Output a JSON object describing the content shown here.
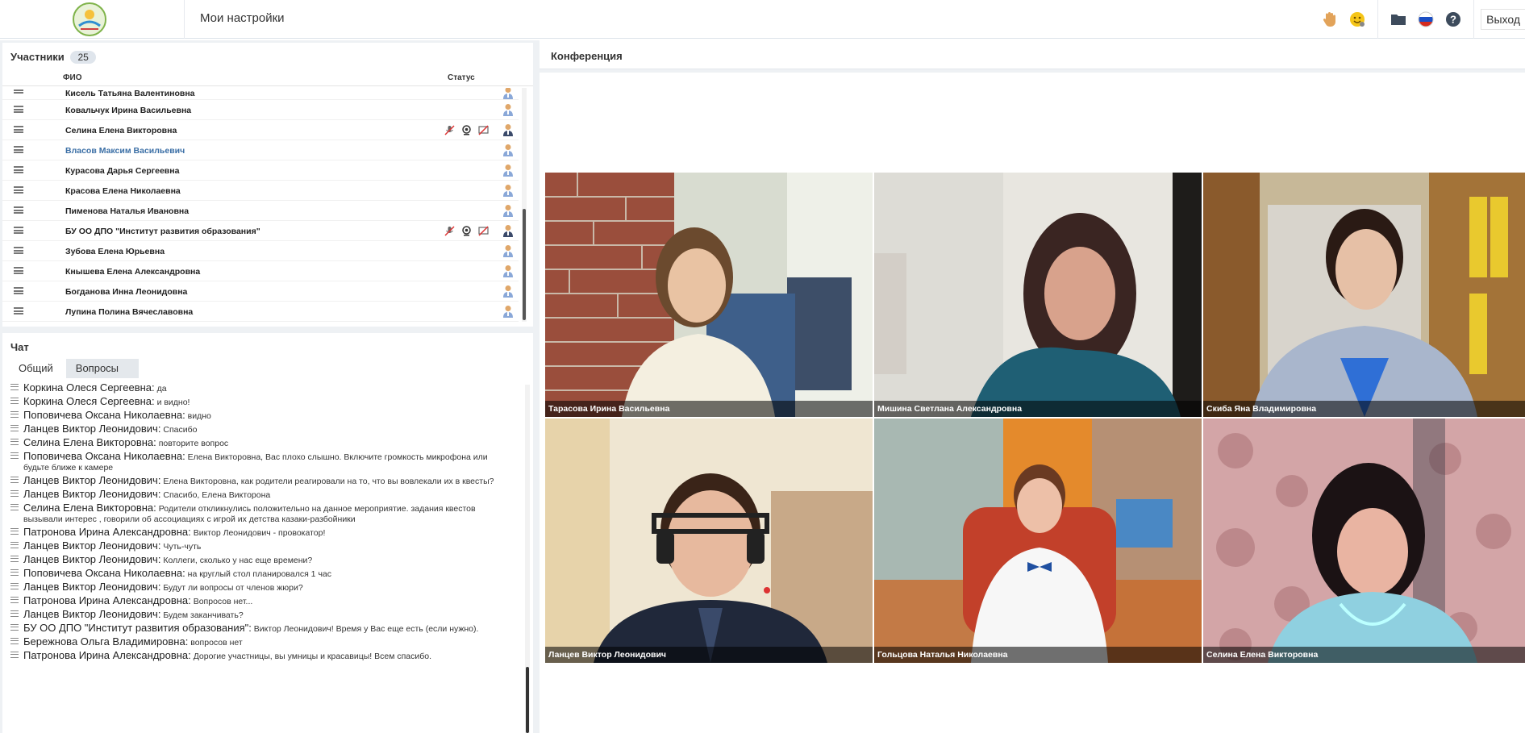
{
  "header": {
    "settings_label": "Мои настройки",
    "exit_label": "Выход"
  },
  "participants": {
    "title": "Участники",
    "count": "25",
    "col_fio": "ФИО",
    "col_status": "Статус",
    "rows": [
      {
        "name": "Кисель Татьяна Валентиновна"
      },
      {
        "name": "Ковальчук Ирина   Васильевна"
      },
      {
        "name": "Селина Елена Викторовна"
      },
      {
        "name": "Власов Максим Васильевич"
      },
      {
        "name": "Курасова Дарья Сергеевна"
      },
      {
        "name": "Красова  Елена Николаевна"
      },
      {
        "name": "Пименова Наталья Ивановна"
      },
      {
        "name": "БУ ОО ДПО \"Институт развития образования\""
      },
      {
        "name": "Зубова Елена Юрьевна"
      },
      {
        "name": "Кнышева Елена Александровна"
      },
      {
        "name": "Богданова Инна Леонидовна"
      },
      {
        "name": "Лупина Полина   Вячеславовна"
      }
    ]
  },
  "chat": {
    "title": "Чат",
    "tab_general": "Общий",
    "tab_questions": "Вопросы",
    "messages": [
      {
        "author": "Коркина Олеся  Сергеевна:",
        "text": "да"
      },
      {
        "author": "Коркина Олеся  Сергеевна:",
        "text": "и видно!"
      },
      {
        "author": "Поповичева Оксана Николаевна:",
        "text": "видно"
      },
      {
        "author": "Ланцев Виктор  Леонидович:",
        "text": "Спасибо"
      },
      {
        "author": "Селина Елена Викторовна:",
        "text": "повторите вопрос"
      },
      {
        "author": "Поповичева Оксана Николаевна:",
        "text": "Елена Викторовна, Вас плохо слышно. Включите громкость микрофона или будьте ближе к камере"
      },
      {
        "author": "Ланцев Виктор  Леонидович:",
        "text": "Елена Викторовна, как родители реагировали на то, что вы вовлекали их в квесты?"
      },
      {
        "author": "Ланцев Виктор  Леонидович:",
        "text": "Спасибо, Елена Викторона"
      },
      {
        "author": "Селина Елена Викторовна:",
        "text": "Родители откликнулись положительно на данное мероприятие. задания квестов вызывали интерес , говорили об ассоциациях с игрой их детства казаки-разбойники"
      },
      {
        "author": "Патронова Ирина  Александровна:",
        "text": "Виктор Леонидович - провокатор!"
      },
      {
        "author": "Ланцев Виктор  Леонидович:",
        "text": "Чуть-чуть"
      },
      {
        "author": "Ланцев Виктор  Леонидович:",
        "text": "Коллеги, сколько у нас еще времени?"
      },
      {
        "author": "Поповичева Оксана Николаевна:",
        "text": "на круглый стол планировался 1 час"
      },
      {
        "author": "Ланцев Виктор  Леонидович:",
        "text": "Будут ли вопросы от членов жюри?"
      },
      {
        "author": "Патронова Ирина  Александровна:",
        "text": "Вопросов нет..."
      },
      {
        "author": "Ланцев Виктор  Леонидович:",
        "text": "Будем заканчивать?"
      },
      {
        "author": "БУ ОО ДПО \"Институт развития образования\":",
        "text": "Виктор Леонидович! Время у Вас еще есть (если нужно)."
      },
      {
        "author": "Бережнова Ольга  Владимировна:",
        "text": "вопросов нет"
      },
      {
        "author": "Патронова Ирина  Александровна:",
        "text": "Дорогие участницы, вы умницы и красавицы! Всем спасибо."
      }
    ]
  },
  "conference": {
    "title": "Конференция",
    "tiles": [
      {
        "name": "Тарасова Ирина Васильевна"
      },
      {
        "name": "Мишина Светлана Александровна"
      },
      {
        "name": "Скиба Яна  Владимировна"
      },
      {
        "name": "Ланцев Виктор  Леонидович"
      },
      {
        "name": "Гольцова Наталья   Николаевна"
      },
      {
        "name": "Селина Елена Викторовна"
      }
    ]
  },
  "colors": {
    "accent_name": "#3a6ea5",
    "panel_bg": "#eef1f4"
  }
}
